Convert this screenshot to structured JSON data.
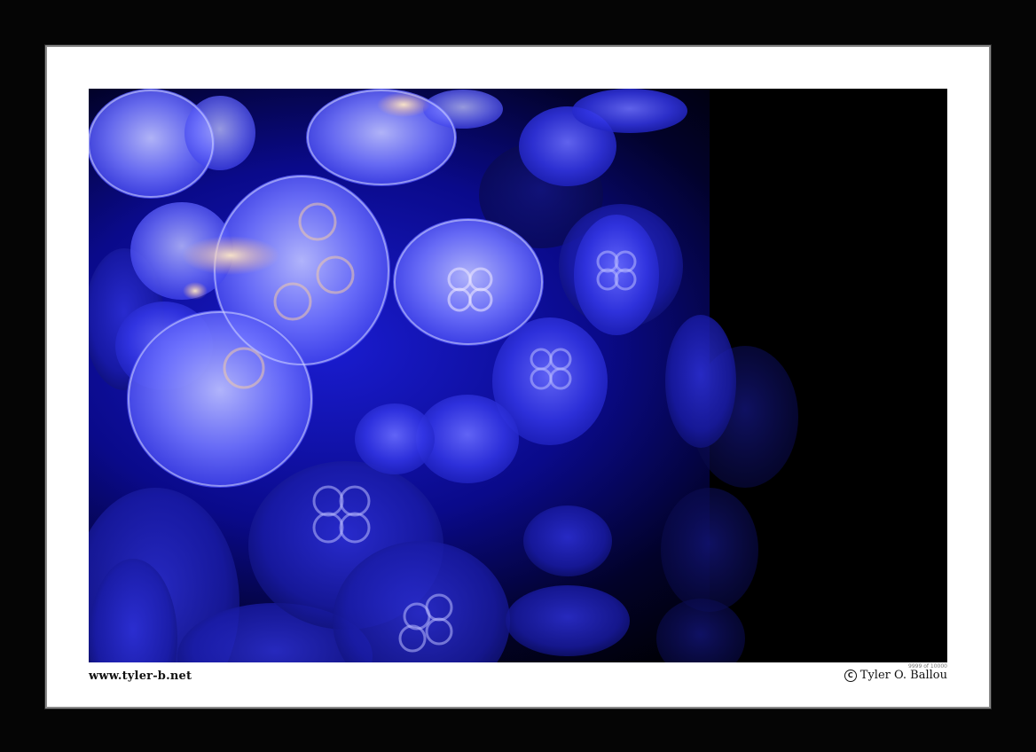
{
  "footer": {
    "website": "www.tyler-b.net",
    "edition": "9999 of 10000",
    "copyright_symbol": "C",
    "author": "Tyler O. Ballou"
  },
  "photo": {
    "subject_icon": "jellyfish-photo",
    "background_color": "#000000",
    "glow_color": "#2a2cff",
    "highlight_color": "#c9cdff"
  },
  "frame": {
    "frame_color": "#050505",
    "mat_color": "#ffffff"
  }
}
